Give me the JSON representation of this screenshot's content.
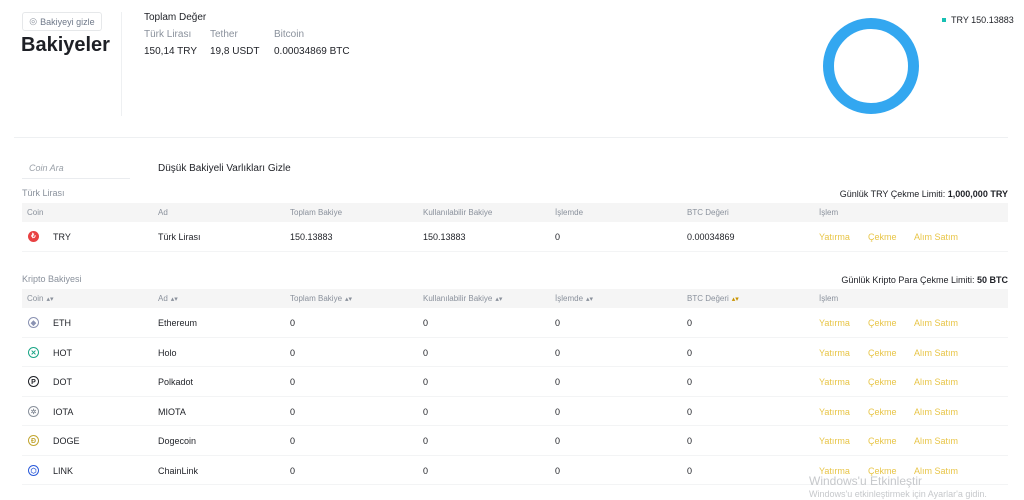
{
  "header": {
    "hide_balance_label": "Bakiyeyi gizle",
    "title": "Bakiyeler",
    "total_title": "Toplam Değer",
    "currencies": [
      {
        "label": "Türk Lirası",
        "value": "150,14 TRY"
      },
      {
        "label": "Tether",
        "value": "19,8 USDT"
      },
      {
        "label": "Bitcoin",
        "value": "0.00034869 BTC"
      }
    ],
    "legend_text": "TRY 150.13883",
    "colors": {
      "donut": "#33a7f0",
      "legend_dot": "#17c0b3"
    }
  },
  "filters": {
    "search_placeholder": "Coin Ara",
    "hide_small_label": "Düşük Bakiyeli Varlıkları Gizle"
  },
  "fiat": {
    "section_label": "Türk Lirası",
    "limit_label": "Günlük TRY Çekme Limiti:",
    "limit_value": "1,000,000 TRY",
    "columns": [
      "Coin",
      "Ad",
      "Toplam Bakiye",
      "Kullanılabilir Bakiye",
      "İşlemde",
      "BTC Değeri",
      "İşlem"
    ],
    "rows": [
      {
        "coin": "TRY",
        "name": "Türk Lirası",
        "total": "150.13883",
        "available": "150.13883",
        "in_order": "0",
        "btc": "0.00034869",
        "icon_color": "#e84142",
        "icon": "tl-icon"
      }
    ]
  },
  "crypto": {
    "section_label": "Kripto Bakiyesi",
    "limit_label": "Günlük Kripto Para Çekme Limiti:",
    "limit_value": "50 BTC",
    "columns": [
      "Coin",
      "Ad",
      "Toplam Bakiye",
      "Kullanılabilir Bakiye",
      "İşlemde",
      "BTC Değeri",
      "İşlem"
    ],
    "rows": [
      {
        "coin": "ETH",
        "name": "Ethereum",
        "total": "0",
        "available": "0",
        "in_order": "0",
        "btc": "0",
        "icon_color": "#8a92b2",
        "icon": "eth-icon"
      },
      {
        "coin": "HOT",
        "name": "Holo",
        "total": "0",
        "available": "0",
        "in_order": "0",
        "btc": "0",
        "icon_color": "#1aa586",
        "icon": "hot-icon"
      },
      {
        "coin": "DOT",
        "name": "Polkadot",
        "total": "0",
        "available": "0",
        "in_order": "0",
        "btc": "0",
        "icon_color": "#1e2026",
        "icon": "dot-icon"
      },
      {
        "coin": "IOTA",
        "name": "MIOTA",
        "total": "0",
        "available": "0",
        "in_order": "0",
        "btc": "0",
        "icon_color": "#8a919c",
        "icon": "iota-icon"
      },
      {
        "coin": "DOGE",
        "name": "Dogecoin",
        "total": "0",
        "available": "0",
        "in_order": "0",
        "btc": "0",
        "icon_color": "#c2a633",
        "icon": "doge-icon"
      },
      {
        "coin": "LINK",
        "name": "ChainLink",
        "total": "0",
        "available": "0",
        "in_order": "0",
        "btc": "0",
        "icon_color": "#2a5ada",
        "icon": "link-icon"
      }
    ]
  },
  "actions": {
    "deposit": "Yatırma",
    "withdraw": "Çekme",
    "trade": "Alım Satım",
    "color": "#e8c547"
  },
  "watermark": {
    "title": "Windows'u Etkinleştir",
    "subtitle": "Windows'u etkinleştirmek için Ayarlar'a gidin."
  }
}
